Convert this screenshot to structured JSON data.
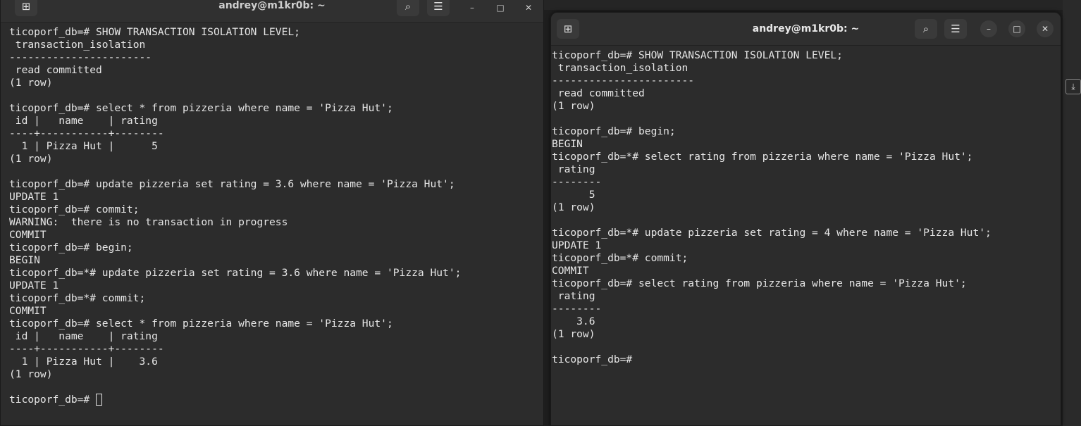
{
  "left_window": {
    "title": "andrey@m1kr0b: ~",
    "lines": [
      "ticoporf_db=# SHOW TRANSACTION ISOLATION LEVEL;",
      " transaction_isolation",
      "-----------------------",
      " read committed",
      "(1 row)",
      "",
      "ticoporf_db=# select * from pizzeria where name = 'Pizza Hut';",
      " id |   name    | rating",
      "----+-----------+--------",
      "  1 | Pizza Hut |      5",
      "(1 row)",
      "",
      "ticoporf_db=# update pizzeria set rating = 3.6 where name = 'Pizza Hut';",
      "UPDATE 1",
      "ticoporf_db=# commit;",
      "WARNING:  there is no transaction in progress",
      "COMMIT",
      "ticoporf_db=# begin;",
      "BEGIN",
      "ticoporf_db=*# update pizzeria set rating = 3.6 where name = 'Pizza Hut';",
      "UPDATE 1",
      "ticoporf_db=*# commit;",
      "COMMIT",
      "ticoporf_db=# select * from pizzeria where name = 'Pizza Hut';",
      " id |   name    | rating",
      "----+-----------+--------",
      "  1 | Pizza Hut |    3.6",
      "(1 row)",
      ""
    ],
    "prompt": "ticoporf_db=# "
  },
  "right_window": {
    "title": "andrey@m1kr0b: ~",
    "lines": [
      "ticoporf_db=# SHOW TRANSACTION ISOLATION LEVEL;",
      " transaction_isolation",
      "-----------------------",
      " read committed",
      "(1 row)",
      "",
      "ticoporf_db=# begin;",
      "BEGIN",
      "ticoporf_db=*# select rating from pizzeria where name = 'Pizza Hut';",
      " rating",
      "--------",
      "      5",
      "(1 row)",
      "",
      "ticoporf_db=*# update pizzeria set rating = 4 where name = 'Pizza Hut';",
      "UPDATE 1",
      "ticoporf_db=*# commit;",
      "COMMIT",
      "ticoporf_db=# select rating from pizzeria where name = 'Pizza Hut';",
      " rating",
      "--------",
      "    3.6",
      "(1 row)",
      "",
      "ticoporf_db=# "
    ]
  },
  "icons": {
    "new_tab": "new-tab-icon",
    "search": "search-icon",
    "menu": "hamburger-menu-icon",
    "minimize": "minimize-icon",
    "maximize": "maximize-icon",
    "close": "close-icon"
  },
  "colors": {
    "terminal_bg": "#2c2c2c",
    "terminal_fg": "#e6e6e6"
  }
}
